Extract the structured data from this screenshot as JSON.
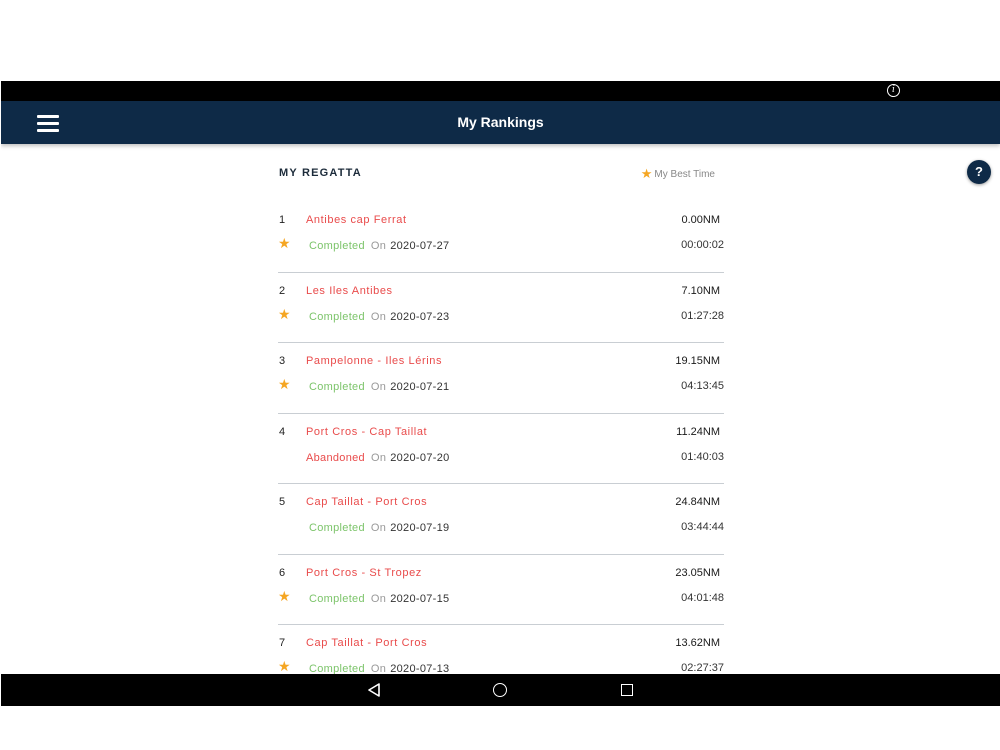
{
  "status_bar": {
    "info_icon": "i"
  },
  "app_bar": {
    "title": "My Rankings",
    "menu_icon": "hamburger-menu-icon"
  },
  "help": {
    "label": "?"
  },
  "section": {
    "title": "MY REGATTA",
    "best_time_legend": "My Best Time",
    "best_star": "★"
  },
  "regattas": [
    {
      "rank": "1",
      "name": "Antibes cap Ferrat",
      "distance": "0.00NM",
      "best": "★",
      "status": "Completed",
      "on": "On",
      "date": "2020-07-27",
      "duration": "00:00:02"
    },
    {
      "rank": "2",
      "name": "Les Iles Antibes",
      "distance": "7.10NM",
      "best": "★",
      "status": "Completed",
      "on": "On",
      "date": "2020-07-23",
      "duration": "01:27:28"
    },
    {
      "rank": "3",
      "name": "Pampelonne - Iles Lérins",
      "distance": "19.15NM",
      "best": "★",
      "status": "Completed",
      "on": "On",
      "date": "2020-07-21",
      "duration": "04:13:45"
    },
    {
      "rank": "4",
      "name": "Port Cros - Cap Taillat",
      "distance": "11.24NM",
      "best": "",
      "status": "Abandoned",
      "on": "On",
      "date": "2020-07-20",
      "duration": "01:40:03"
    },
    {
      "rank": "5",
      "name": "Cap Taillat - Port Cros",
      "distance": "24.84NM",
      "best": "",
      "status": "Completed",
      "on": "On",
      "date": "2020-07-19",
      "duration": "03:44:44"
    },
    {
      "rank": "6",
      "name": "Port Cros - St Tropez",
      "distance": "23.05NM",
      "best": "★",
      "status": "Completed",
      "on": "On",
      "date": "2020-07-15",
      "duration": "04:01:48"
    },
    {
      "rank": "7",
      "name": "Cap Taillat - Port Cros",
      "distance": "13.62NM",
      "best": "★",
      "status": "Completed",
      "on": "On",
      "date": "2020-07-13",
      "duration": "02:27:37"
    }
  ],
  "colors": {
    "app_bar": "#0e2a47",
    "regatta_name": "#e94b4b",
    "completed": "#7cc46a",
    "abandoned": "#e94b4b",
    "star": "#f5a623"
  },
  "nav_bar": {
    "back_icon": "back-triangle-icon",
    "home_icon": "home-circle-icon",
    "recents_icon": "recents-square-icon"
  }
}
